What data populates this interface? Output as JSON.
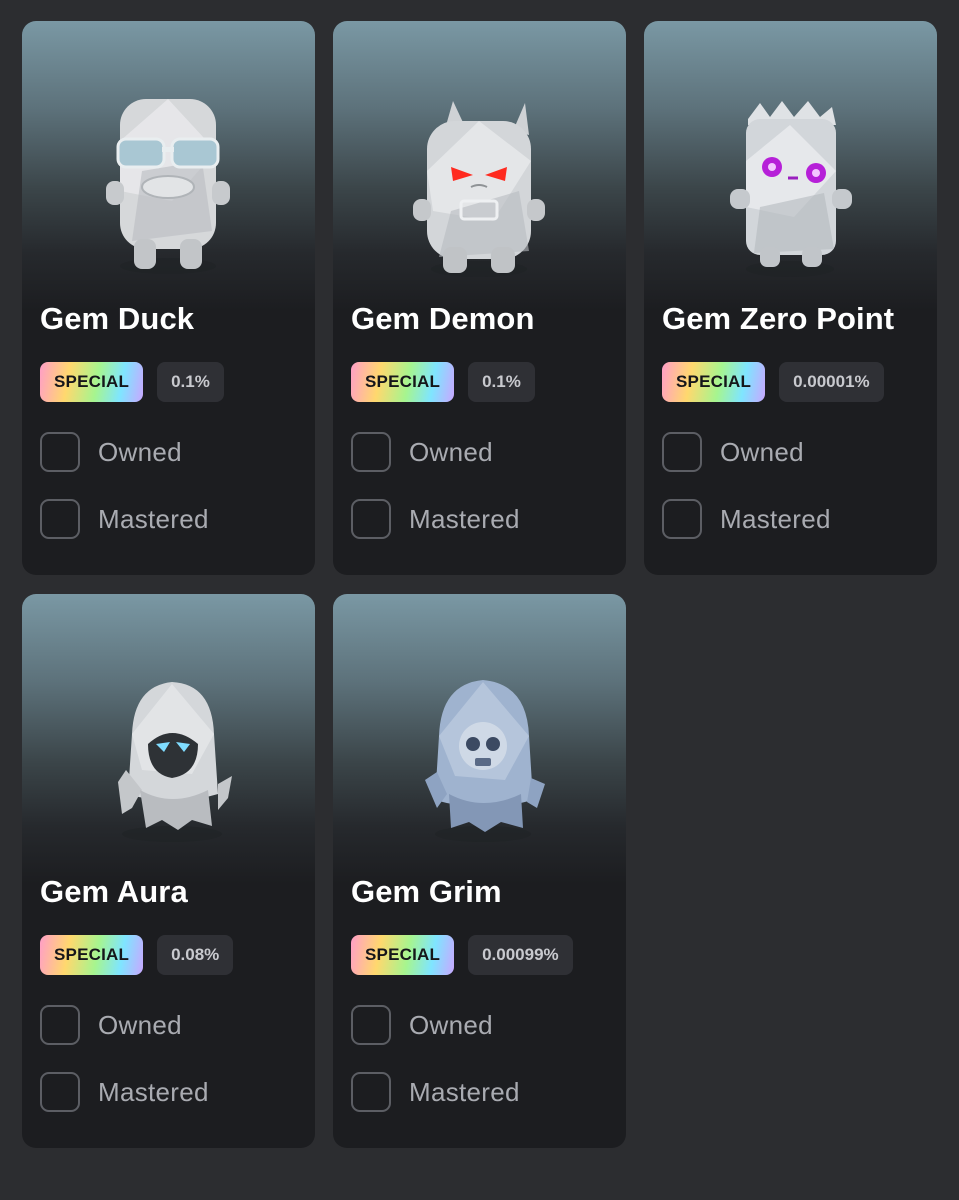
{
  "cards": [
    {
      "name": "Gem Duck",
      "badge": "SPECIAL",
      "rate": "0.1%",
      "owned_label": "Owned",
      "mastered_label": "Mastered",
      "icon": "gem-duck-icon"
    },
    {
      "name": "Gem Demon",
      "badge": "SPECIAL",
      "rate": "0.1%",
      "owned_label": "Owned",
      "mastered_label": "Mastered",
      "icon": "gem-demon-icon"
    },
    {
      "name": "Gem Zero Point",
      "badge": "SPECIAL",
      "rate": "0.00001%",
      "owned_label": "Owned",
      "mastered_label": "Mastered",
      "icon": "gem-zero-point-icon"
    },
    {
      "name": "Gem Aura",
      "badge": "SPECIAL",
      "rate": "0.08%",
      "owned_label": "Owned",
      "mastered_label": "Mastered",
      "icon": "gem-aura-icon"
    },
    {
      "name": "Gem Grim",
      "badge": "SPECIAL",
      "rate": "0.00099%",
      "owned_label": "Owned",
      "mastered_label": "Mastered",
      "icon": "gem-grim-icon"
    }
  ],
  "colors": {
    "page_bg": "#2c2d30",
    "card_bg": "#1c1d20",
    "art_top": "#7a98a4",
    "text": "#ffffff",
    "muted_text": "#a9abb1"
  }
}
